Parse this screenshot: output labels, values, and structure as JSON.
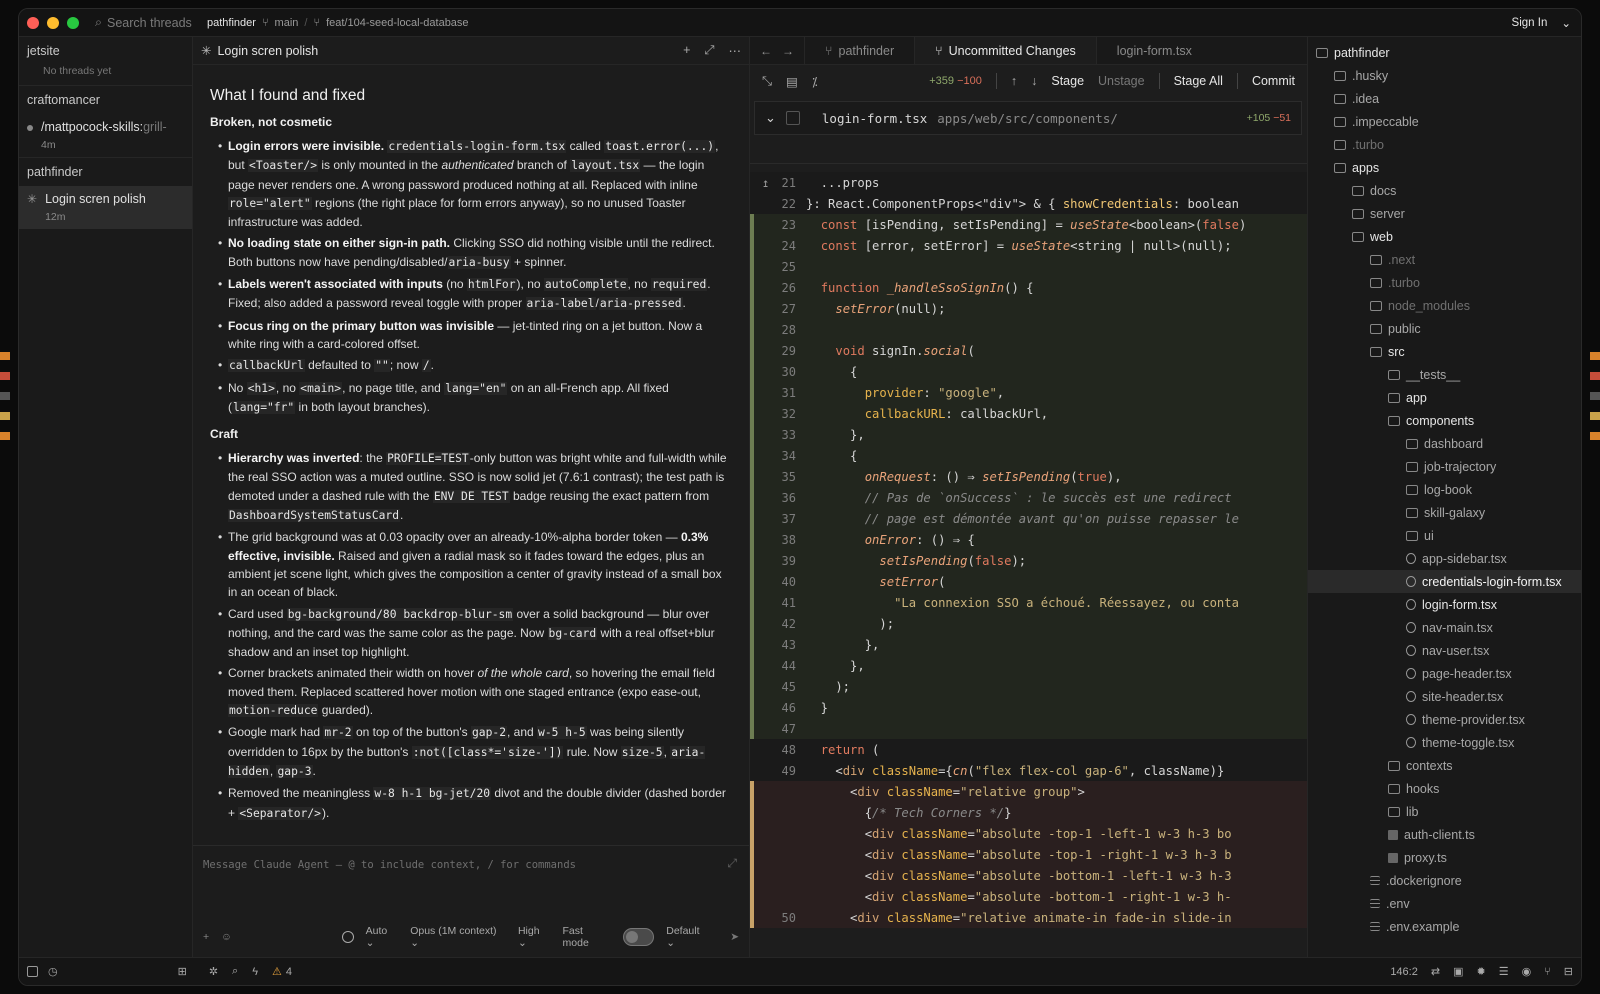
{
  "titlebar": {
    "search_placeholder": "Search threads",
    "project": "pathfinder",
    "branch": "main",
    "feature_branch": "feat/104-seed-local-database",
    "sign_in": "Sign In"
  },
  "sidebar": {
    "projects": [
      {
        "name": "jetsite",
        "empty_text": "No threads yet"
      },
      {
        "name": "craftomancer",
        "thread_title": "/mattpocock-skills:",
        "thread_title_dim": "grill-",
        "thread_age": "4m"
      },
      {
        "name": "pathfinder",
        "thread_title": "Login scren polish",
        "thread_age": "12m"
      }
    ]
  },
  "chat": {
    "title": "Login scren polish",
    "heading": "What I found and fixed",
    "section1": "Broken, not cosmetic",
    "section2": "Craft",
    "composer_placeholder": "Message Claude Agent — @ to include context, / for commands",
    "mode": "Auto",
    "model": "Opus (1M context)",
    "effort": "High",
    "fast_mode": "Fast mode",
    "permission": "Default"
  },
  "diff": {
    "tabs": [
      "pathfinder",
      "Uncommitted Changes",
      "login-form.tsx"
    ],
    "total_add": "+359",
    "total_del": "−100",
    "stage": "Stage",
    "unstage": "Unstage",
    "stage_all": "Stage All",
    "commit": "Commit",
    "file_name": "login-form.tsx",
    "file_path": "apps/web/src/components/",
    "file_add": "+105",
    "file_del": "−51"
  },
  "tree": {
    "root": "pathfinder"
  },
  "status": {
    "warnings": "4",
    "cursor": "146:2"
  }
}
